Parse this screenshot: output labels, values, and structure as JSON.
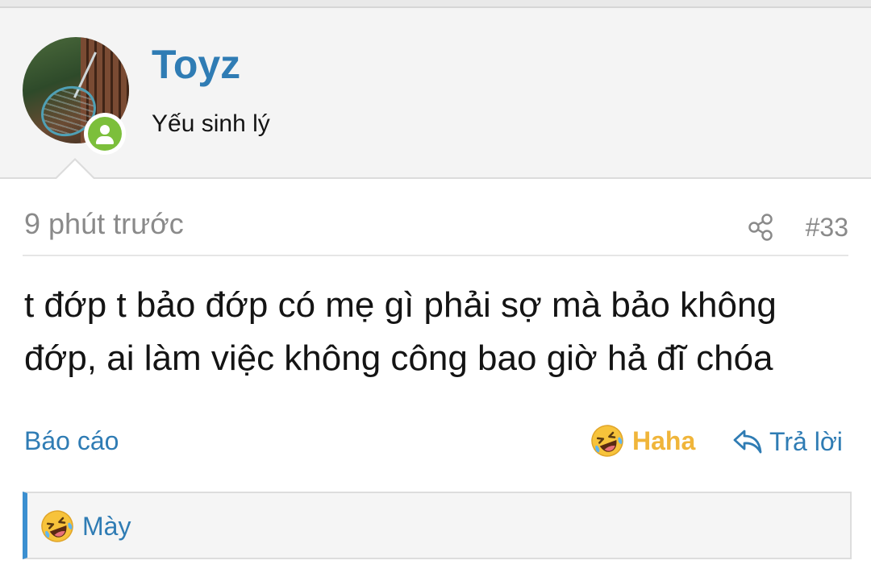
{
  "user": {
    "name": "Toyz",
    "title": "Yếu sinh lý",
    "status": "online"
  },
  "post": {
    "time": "9 phút trước",
    "number": "#33",
    "body": "t đớp t bảo đớp có mẹ gì phải sợ mà bảo không đớp, ai làm việc không công bao giờ hả đĩ chóa"
  },
  "actions": {
    "report_label": "Báo cáo",
    "reaction_label": "Haha",
    "reply_label": "Trả lời"
  },
  "reactions_bar": {
    "users": "Mày"
  },
  "colors": {
    "link": "#2f7cb4",
    "reaction": "#f0b53a",
    "online": "#7cbf3b",
    "accent_border": "#3b8fd0"
  },
  "icons": [
    "avatar",
    "online-person-icon",
    "share-icon",
    "laughing-emoji-icon",
    "reply-arrow-icon"
  ]
}
